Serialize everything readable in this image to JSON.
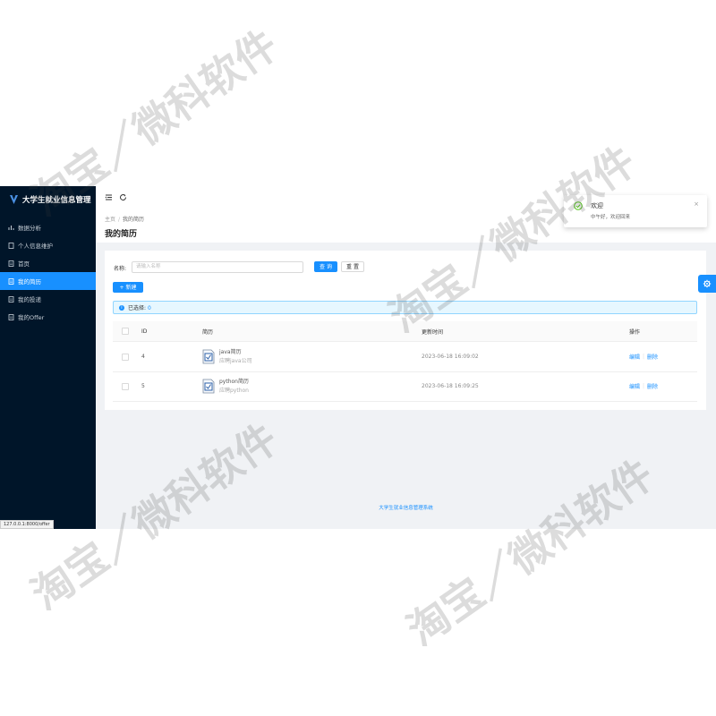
{
  "app": {
    "title": "大学生就业信息管理"
  },
  "sidebar": {
    "items": [
      {
        "label": "数据分析",
        "icon": "chart-icon"
      },
      {
        "label": "个人信息维护",
        "icon": "user-icon"
      },
      {
        "label": "首页",
        "icon": "doc-icon"
      },
      {
        "label": "我的简历",
        "icon": "doc-icon",
        "active": true
      },
      {
        "label": "我的投递",
        "icon": "doc-icon"
      },
      {
        "label": "我的Offer",
        "icon": "doc-icon"
      }
    ]
  },
  "header": {
    "icons": [
      "menu-fold-icon",
      "refresh-icon"
    ]
  },
  "breadcrumb": {
    "home": "主页",
    "sep": "/",
    "current": "我的简历"
  },
  "page": {
    "title": "我的简历"
  },
  "search": {
    "label": "名称:",
    "placeholder": "请输入名称",
    "query_btn": "查 询",
    "reset_btn": "重 置"
  },
  "toolbar": {
    "new_btn": "+ 新建"
  },
  "alert": {
    "prefix": "已选择:",
    "count": "0",
    "icon": "info-icon"
  },
  "table": {
    "columns": [
      "ID",
      "简历",
      "更新时间",
      "操作"
    ],
    "rows": [
      {
        "id": "4",
        "name": "java简历",
        "sub": "应聘java公司",
        "updated": "2023-06-18 16:09:02",
        "edit": "编辑",
        "delete": "删除"
      },
      {
        "id": "5",
        "name": "python简历",
        "sub": "应聘python",
        "updated": "2023-06-18 16:09:25",
        "edit": "编辑",
        "delete": "删除"
      }
    ]
  },
  "footer": {
    "text": "大学生就业信息管理系统"
  },
  "notification": {
    "title": "欢迎",
    "desc": "中午好，欢迎回来",
    "icon": "check-circle-icon"
  },
  "status_bar": {
    "url": "127.0.0.1:8000/offer"
  },
  "watermark": {
    "text": "淘宝／微科软件"
  },
  "colors": {
    "primary": "#1890ff",
    "sidebar": "#001529",
    "success": "#52c41a"
  }
}
